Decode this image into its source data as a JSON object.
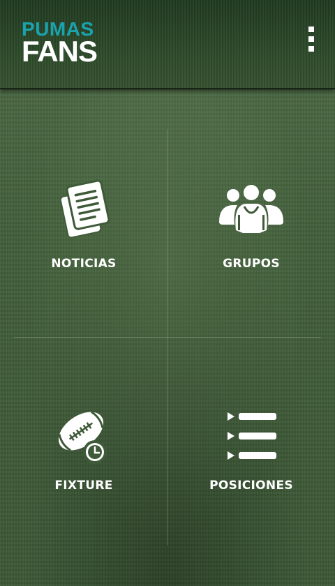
{
  "app": {
    "logo_top": "PUMAS",
    "logo_bottom": "FANS",
    "menu_icon": "more-vertical-icon"
  },
  "colors": {
    "brand_teal": "#1ba3ad",
    "grass": "#415e3a",
    "text": "#ffffff"
  },
  "tiles": [
    {
      "label": "NOTICIAS",
      "icon": "news-icon"
    },
    {
      "label": "GRUPOS",
      "icon": "group-icon"
    },
    {
      "label": "FIXTURE",
      "icon": "rugby-ball-clock-icon"
    },
    {
      "label": "POSICIONES",
      "icon": "list-icon"
    }
  ]
}
